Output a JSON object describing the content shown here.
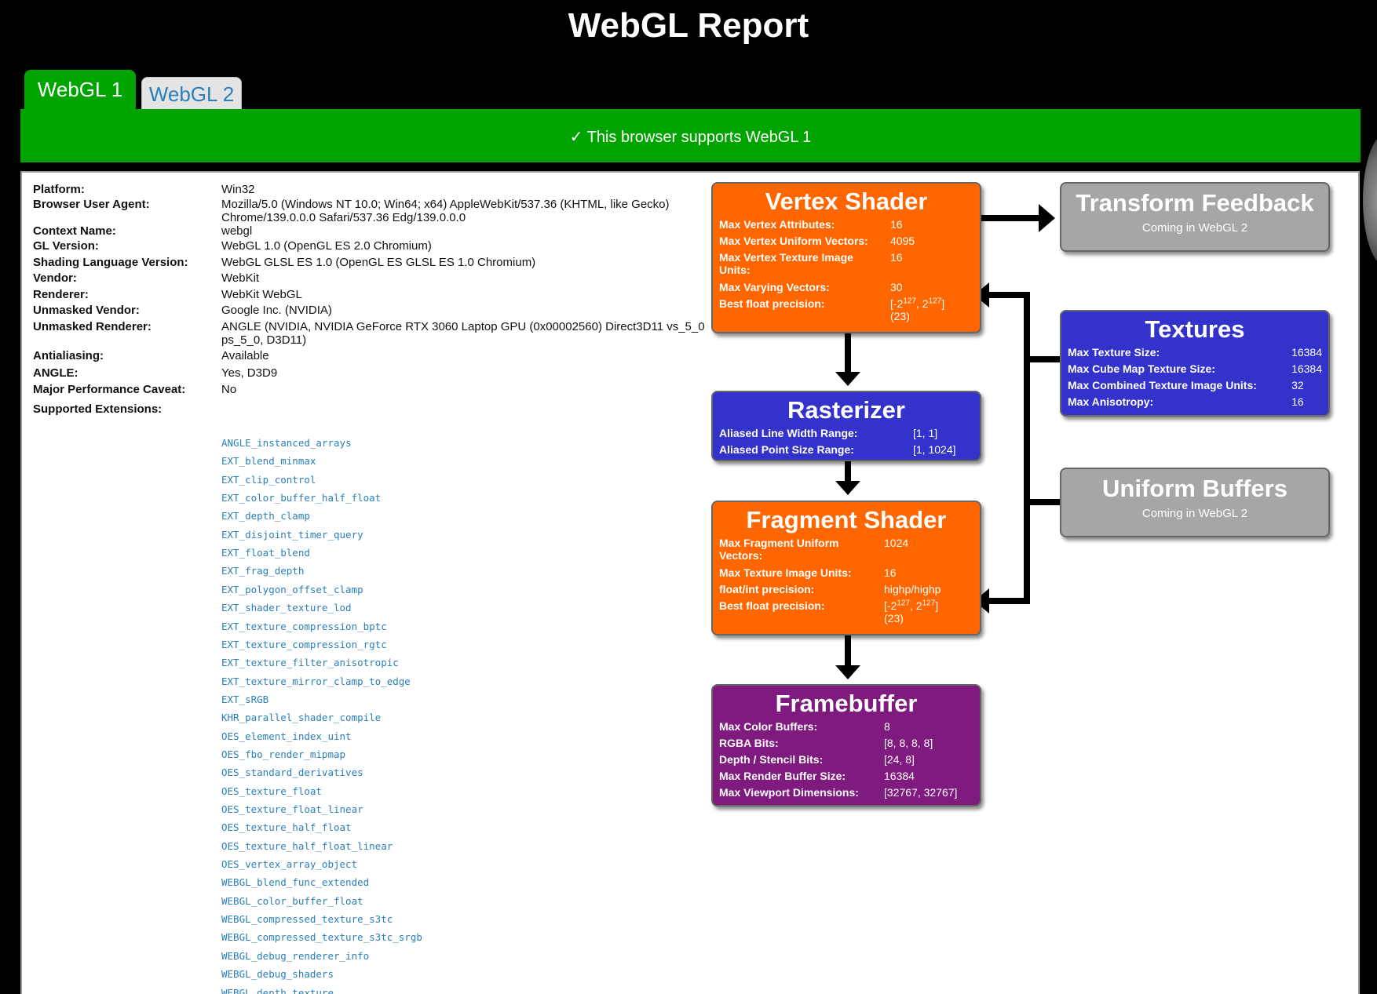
{
  "page_title": "WebGL Report",
  "tabs": [
    {
      "label": "WebGL 1",
      "active": true
    },
    {
      "label": "WebGL 2",
      "active": false
    }
  ],
  "banner": {
    "check": "✓",
    "text": " This browser supports WebGL 1"
  },
  "colors": {
    "green": "#00a400",
    "orange": "#ff6600",
    "blue": "#3333cc",
    "purple": "#7f1a7f",
    "gray": "#a6a6a6",
    "link": "#2a7fb8"
  },
  "info": [
    {
      "label": "Platform:",
      "value": "Win32"
    },
    {
      "label": "Browser User Agent:",
      "value": "Mozilla/5.0 (Windows NT 10.0; Win64; x64) AppleWebKit/537.36 (KHTML, like Gecko) Chrome/139.0.0.0 Safari/537.36 Edg/139.0.0.0"
    },
    {
      "label": "Context Name:",
      "value": "webgl"
    },
    {
      "label": "GL Version:",
      "value": "WebGL 1.0 (OpenGL ES 2.0 Chromium)"
    },
    {
      "label": "Shading Language Version:",
      "value": "WebGL GLSL ES 1.0 (OpenGL ES GLSL ES 1.0 Chromium)"
    },
    {
      "label": "Vendor:",
      "value": "WebKit"
    },
    {
      "label": "Renderer:",
      "value": "WebKit WebGL"
    },
    {
      "label": "Unmasked Vendor:",
      "value": "Google Inc. (NVIDIA)"
    },
    {
      "label": "Unmasked Renderer:",
      "value": "ANGLE (NVIDIA, NVIDIA GeForce RTX 3060 Laptop GPU (0x00002560) Direct3D11 vs_5_0 ps_5_0, D3D11)"
    },
    {
      "label": "Antialiasing:",
      "value": "Available"
    },
    {
      "label": "ANGLE:",
      "value": "Yes, D3D9"
    },
    {
      "label": "Major Performance Caveat:",
      "value": "No"
    }
  ],
  "extensions_label": "Supported Extensions:",
  "extensions": [
    "ANGLE_instanced_arrays",
    "EXT_blend_minmax",
    "EXT_clip_control",
    "EXT_color_buffer_half_float",
    "EXT_depth_clamp",
    "EXT_disjoint_timer_query",
    "EXT_float_blend",
    "EXT_frag_depth",
    "EXT_polygon_offset_clamp",
    "EXT_shader_texture_lod",
    "EXT_texture_compression_bptc",
    "EXT_texture_compression_rgtc",
    "EXT_texture_filter_anisotropic",
    "EXT_texture_mirror_clamp_to_edge",
    "EXT_sRGB",
    "KHR_parallel_shader_compile",
    "OES_element_index_uint",
    "OES_fbo_render_mipmap",
    "OES_standard_derivatives",
    "OES_texture_float",
    "OES_texture_float_linear",
    "OES_texture_half_float",
    "OES_texture_half_float_linear",
    "OES_vertex_array_object",
    "WEBGL_blend_func_extended",
    "WEBGL_color_buffer_float",
    "WEBGL_compressed_texture_s3tc",
    "WEBGL_compressed_texture_s3tc_srgb",
    "WEBGL_debug_renderer_info",
    "WEBGL_debug_shaders",
    "WEBGL_depth_texture"
  ],
  "pipeline": {
    "vertex": {
      "title": "Vertex Shader",
      "rows": [
        {
          "k": "Max Vertex Attributes:",
          "v": "16"
        },
        {
          "k": "Max Vertex Uniform Vectors:",
          "v": "4095"
        },
        {
          "k": "Max Vertex Texture Image Units:",
          "v": "16"
        },
        {
          "k": "Max Varying Vectors:",
          "v": "30"
        }
      ],
      "precision_label": "Best float precision:",
      "precision": {
        "open": "[-2",
        "exp1": "127",
        "mid": ", 2",
        "exp2": "127",
        "close": "]",
        "bits": "(23)"
      }
    },
    "rasterizer": {
      "title": "Rasterizer",
      "rows": [
        {
          "k": "Aliased Line Width Range:",
          "v": "[1, 1]"
        },
        {
          "k": "Aliased Point Size Range:",
          "v": "[1, 1024]"
        }
      ]
    },
    "fragment": {
      "title": "Fragment Shader",
      "rows": [
        {
          "k": "Max Fragment Uniform Vectors:",
          "v": "1024"
        },
        {
          "k": "Max Texture Image Units:",
          "v": "16"
        },
        {
          "k": "float/int precision:",
          "v": "highp/highp"
        }
      ],
      "precision_label": "Best float precision:",
      "precision": {
        "open": "[-2",
        "exp1": "127",
        "mid": ", 2",
        "exp2": "127",
        "close": "]",
        "bits": "(23)"
      }
    },
    "framebuffer": {
      "title": "Framebuffer",
      "rows": [
        {
          "k": "Max Color Buffers:",
          "v": "8"
        },
        {
          "k": "RGBA Bits:",
          "v": "[8, 8, 8, 8]"
        },
        {
          "k": "Depth / Stencil Bits:",
          "v": "[24, 8]"
        },
        {
          "k": "Max Render Buffer Size:",
          "v": "16384"
        },
        {
          "k": "Max Viewport Dimensions:",
          "v": "[32767, 32767]"
        }
      ]
    },
    "transform_feedback": {
      "title": "Transform Feedback",
      "sub": "Coming in WebGL 2"
    },
    "textures": {
      "title": "Textures",
      "rows": [
        {
          "k": "Max Texture Size:",
          "v": "16384"
        },
        {
          "k": "Max Cube Map Texture Size:",
          "v": "16384"
        },
        {
          "k": "Max Combined Texture Image Units:",
          "v": "32"
        },
        {
          "k": "Max Anisotropy:",
          "v": "16"
        }
      ]
    },
    "uniform_buffers": {
      "title": "Uniform Buffers",
      "sub": "Coming in WebGL 2"
    }
  }
}
